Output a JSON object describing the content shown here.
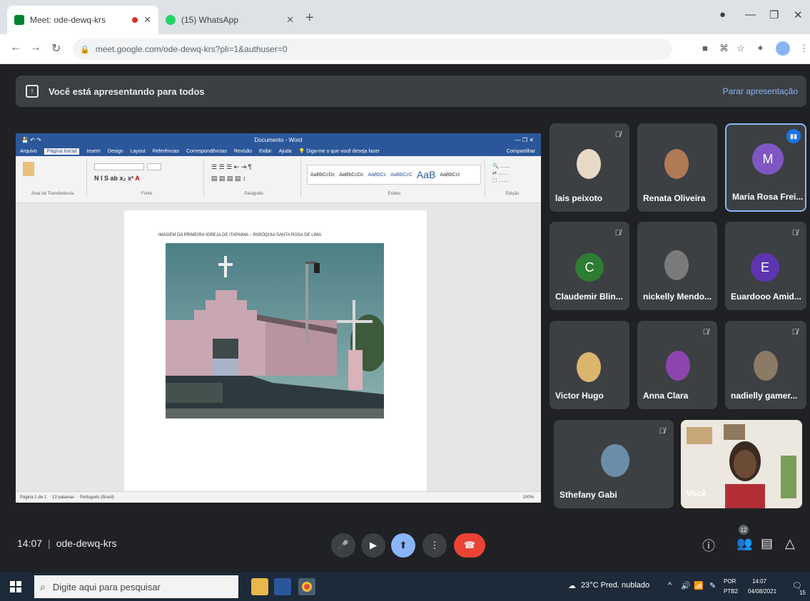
{
  "browser": {
    "tabs": [
      {
        "title": "Meet: ode-dewq-krs",
        "recording": true
      },
      {
        "title": "(15) WhatsApp"
      }
    ],
    "address": "meet.google.com/ode-dewq-krs?pli=1&authuser=0"
  },
  "presenting": {
    "message": "Você está apresentando para todos",
    "stop_label": "Parar apresentação"
  },
  "word": {
    "tabs": [
      "Arquivo",
      "Página Inicial",
      "Inserir",
      "Design",
      "Layout",
      "Referências",
      "Correspondências",
      "Revisão",
      "Exibir",
      "Ajuda"
    ],
    "tell_me": "Diga-me o que você deseja fazer",
    "share": "Compartilhar",
    "style_sample": "AaB",
    "groups": [
      "Área de Transferência",
      "Fonte",
      "Parágrafo",
      "Estilos",
      "Edição"
    ],
    "caption": "IMAGEM DA PRIMEIRA IGREJA DE ITAPAIMA – PARÓQUIA SANTA ROSA DE LIMA",
    "status": {
      "page": "Página 1 de 1",
      "words": "13 palavras",
      "lang": "Português (Brasil)",
      "zoom": "100%"
    }
  },
  "participants": [
    {
      "name": "lais peixoto",
      "muted": true,
      "avatar": "photo"
    },
    {
      "name": "Renata Oliveira",
      "muted": false,
      "avatar": "photo"
    },
    {
      "name": "Maria Rosa Frei...",
      "muted": false,
      "speaking": true,
      "initial": "M",
      "color": "#7e57c2"
    },
    {
      "name": "Claudemir Blin...",
      "muted": true,
      "initial": "C",
      "color": "#2e7d32"
    },
    {
      "name": "nickelly Mendo...",
      "muted": false,
      "avatar": "photo"
    },
    {
      "name": "Euardooo Amid...",
      "muted": true,
      "initial": "E",
      "color": "#5e35b1"
    },
    {
      "name": "Victor Hugo",
      "muted": false,
      "avatar": "photo"
    },
    {
      "name": "Anna Clara",
      "muted": true,
      "avatar": "photo"
    },
    {
      "name": "nadielly gamer...",
      "muted": true,
      "avatar": "photo"
    },
    {
      "name": "Sthefany Gabi",
      "muted": true,
      "avatar": "photo"
    },
    {
      "name": "Você",
      "muted": false,
      "avatar": "video"
    }
  ],
  "meet_bar": {
    "time": "14:07",
    "code": "ode-dewq-krs",
    "participants_badge": "12"
  },
  "taskbar": {
    "search_placeholder": "Digite aqui para pesquisar",
    "weather": "23°C Pred. nublado",
    "lang_top": "POR",
    "lang_bottom": "PTB2",
    "time": "14:07",
    "date": "04/08/2021",
    "notif_count": "15"
  },
  "colors": {
    "meet_bg": "#202124",
    "tile_bg": "#3c4043",
    "accent": "#8ab4f8",
    "hangup": "#ea4335",
    "word_blue": "#2b579a"
  }
}
